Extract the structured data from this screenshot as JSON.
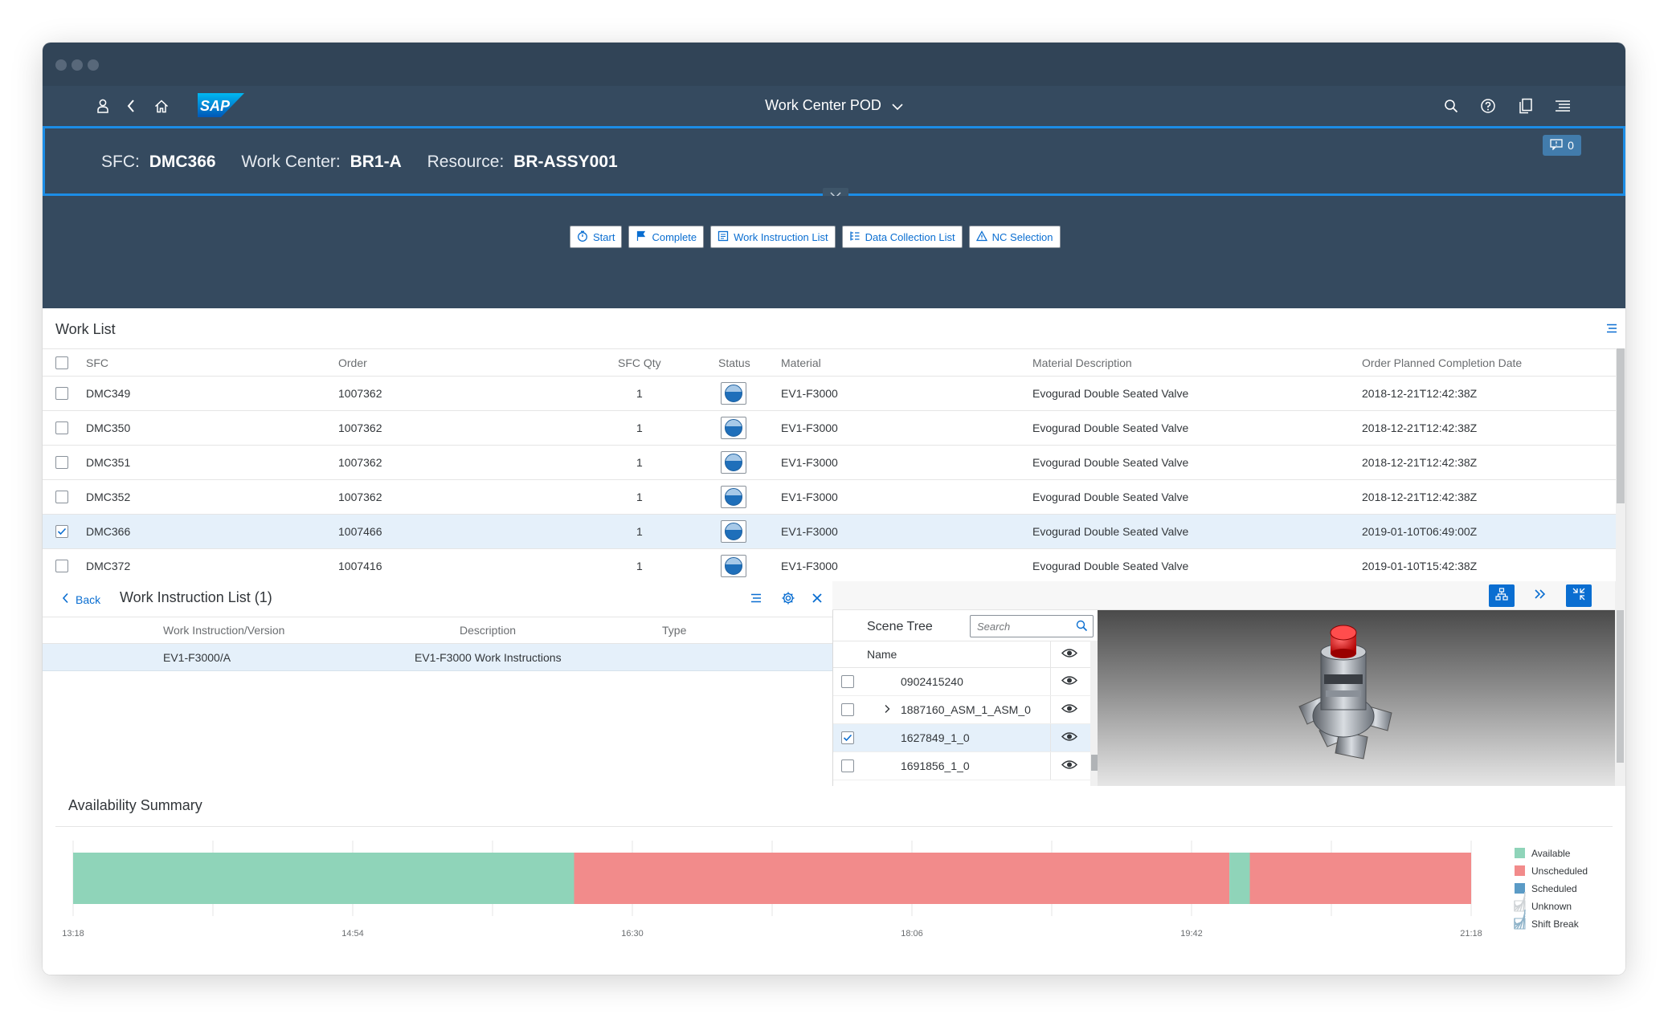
{
  "shellbar": {
    "title": "Work Center POD",
    "icons": [
      "person-icon",
      "back-icon",
      "home-icon",
      "sap-logo",
      "search-icon",
      "help-icon",
      "copy-icon",
      "menu-icon"
    ]
  },
  "header": {
    "sfc_label": "SFC:",
    "sfc_value": "DMC366",
    "wc_label": "Work Center:",
    "wc_value": "BR1-A",
    "res_label": "Resource:",
    "res_value": "BR-ASSY001",
    "notification_count": "0"
  },
  "toolbar": {
    "start": "Start",
    "complete": "Complete",
    "work_instruction_list": "Work Instruction List",
    "data_collection_list": "Data Collection List",
    "nc_selection": "NC Selection"
  },
  "worklist": {
    "title": "Work List",
    "columns": [
      "SFC",
      "Order",
      "SFC Qty",
      "Status",
      "Material",
      "Material Description",
      "Order Planned Completion Date"
    ],
    "rows": [
      {
        "sfc": "DMC349",
        "order": "1007362",
        "qty": "1",
        "material": "EV1-F3000",
        "description": "Evogurad Double Seated Valve",
        "date": "2018-12-21T12:42:38Z",
        "selected": false
      },
      {
        "sfc": "DMC350",
        "order": "1007362",
        "qty": "1",
        "material": "EV1-F3000",
        "description": "Evogurad Double Seated Valve",
        "date": "2018-12-21T12:42:38Z",
        "selected": false
      },
      {
        "sfc": "DMC351",
        "order": "1007362",
        "qty": "1",
        "material": "EV1-F3000",
        "description": "Evogurad Double Seated Valve",
        "date": "2018-12-21T12:42:38Z",
        "selected": false
      },
      {
        "sfc": "DMC352",
        "order": "1007362",
        "qty": "1",
        "material": "EV1-F3000",
        "description": "Evogurad Double Seated Valve",
        "date": "2018-12-21T12:42:38Z",
        "selected": false
      },
      {
        "sfc": "DMC366",
        "order": "1007466",
        "qty": "1",
        "material": "EV1-F3000",
        "description": "Evogurad Double Seated Valve",
        "date": "2019-01-10T06:49:00Z",
        "selected": true
      },
      {
        "sfc": "DMC372",
        "order": "1007416",
        "qty": "1",
        "material": "EV1-F3000",
        "description": "Evogurad Double Seated Valve",
        "date": "2019-01-10T15:42:38Z",
        "selected": false
      }
    ]
  },
  "work_instructions": {
    "back_label": "Back",
    "title": "Work Instruction List (1)",
    "columns": [
      "Work Instruction/Version",
      "Description",
      "Type"
    ],
    "rows": [
      {
        "version": "EV1-F3000/A",
        "description": "EV1-F3000 Work Instructions",
        "type": ""
      }
    ]
  },
  "scene_tree": {
    "title": "Scene Tree",
    "search_placeholder": "Search",
    "name_header": "Name",
    "nodes": [
      {
        "name": "0902415240",
        "checked": false,
        "expandable": false
      },
      {
        "name": "1887160_ASM_1_ASM_0",
        "checked": false,
        "expandable": true
      },
      {
        "name": "1627849_1_0",
        "checked": true,
        "expandable": false
      },
      {
        "name": "1691856_1_0",
        "checked": false,
        "expandable": false
      }
    ]
  },
  "availability": {
    "title": "Availability Summary"
  },
  "chart_data": {
    "type": "bar",
    "orientation": "horizontal-timeline",
    "x_tick_labels": [
      "13:18",
      "14:54",
      "16:30",
      "18:06",
      "19:42",
      "21:18"
    ],
    "segments": [
      {
        "status": "Available",
        "start": "13:18",
        "end": "16:10"
      },
      {
        "status": "Unscheduled",
        "start": "16:10",
        "end": "19:55"
      },
      {
        "status": "Available",
        "start": "19:55",
        "end": "20:02"
      },
      {
        "status": "Unscheduled",
        "start": "20:02",
        "end": "21:18"
      }
    ],
    "legend": [
      {
        "name": "Available",
        "color": "#8fd4b9"
      },
      {
        "name": "Unscheduled",
        "color": "#f28b8b"
      },
      {
        "name": "Scheduled",
        "color": "#5b9bc6"
      },
      {
        "name": "Unknown",
        "color": "#cfd3d6"
      },
      {
        "name": "Shift Break",
        "color": "#8fb3c9"
      }
    ],
    "legend_position": "right"
  },
  "colors": {
    "shell": "#354a5f",
    "accent": "#0a6ed1",
    "available": "#8fd4b9",
    "unscheduled": "#f28b8b"
  }
}
